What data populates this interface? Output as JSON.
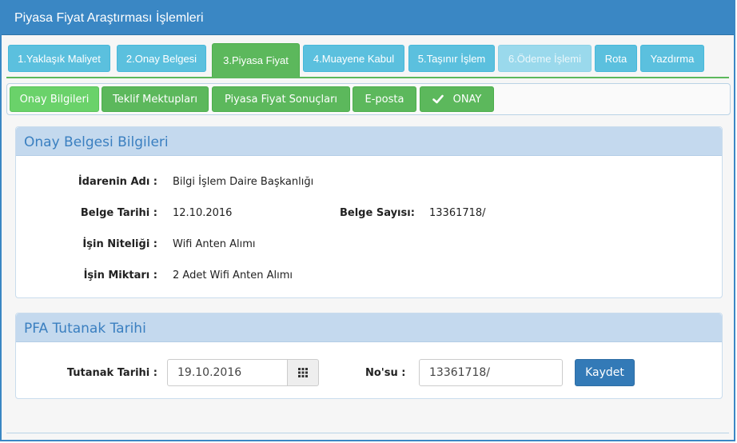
{
  "window": {
    "title": "Piyasa Fiyat Araştırması İşlemleri"
  },
  "tabs": [
    {
      "label": "1.Yaklaşık Maliyet"
    },
    {
      "label": "2.Onay Belgesi"
    },
    {
      "label": "3.Piyasa Fiyat"
    },
    {
      "label": "4.Muayene Kabul"
    },
    {
      "label": "5.Taşınır İşlem"
    },
    {
      "label": "6.Ödeme İşlemi"
    },
    {
      "label": "Rota"
    },
    {
      "label": "Yazdırma"
    }
  ],
  "subtabs": [
    {
      "label": "Onay Bilgileri"
    },
    {
      "label": "Teklif Mektupları"
    },
    {
      "label": "Piyasa Fiyat Sonuçları"
    },
    {
      "label": "E-posta"
    },
    {
      "label": "ONAY"
    }
  ],
  "onay_panel": {
    "title": "Onay Belgesi Bilgileri",
    "idare_label": "İdarenin Adı :",
    "idare_value": "Bilgi İşlem Daire Başkanlığı",
    "tarih_label": "Belge Tarihi :",
    "tarih_value": "12.10.2016",
    "sayi_label": "Belge Sayısı:",
    "sayi_value": "13361718/",
    "nitelik_label": "İşin Niteliği :",
    "nitelik_value": "Wifi Anten Alımı",
    "miktar_label": "İşin Miktarı :",
    "miktar_value": "2 Adet Wifi Anten Alımı"
  },
  "pfa_panel": {
    "title": "PFA Tutanak Tarihi",
    "tutanak_label": "Tutanak Tarihi :",
    "tutanak_value": "19.10.2016",
    "no_label": "No'su :",
    "no_value": "13361718/",
    "save_label": "Kaydet"
  },
  "colors": {
    "title_bar": "#3a87c4",
    "tab_info": "#5bc0de",
    "tab_active": "#5cb85c",
    "panel_head": "#c4d9ee",
    "primary": "#337ab7"
  }
}
